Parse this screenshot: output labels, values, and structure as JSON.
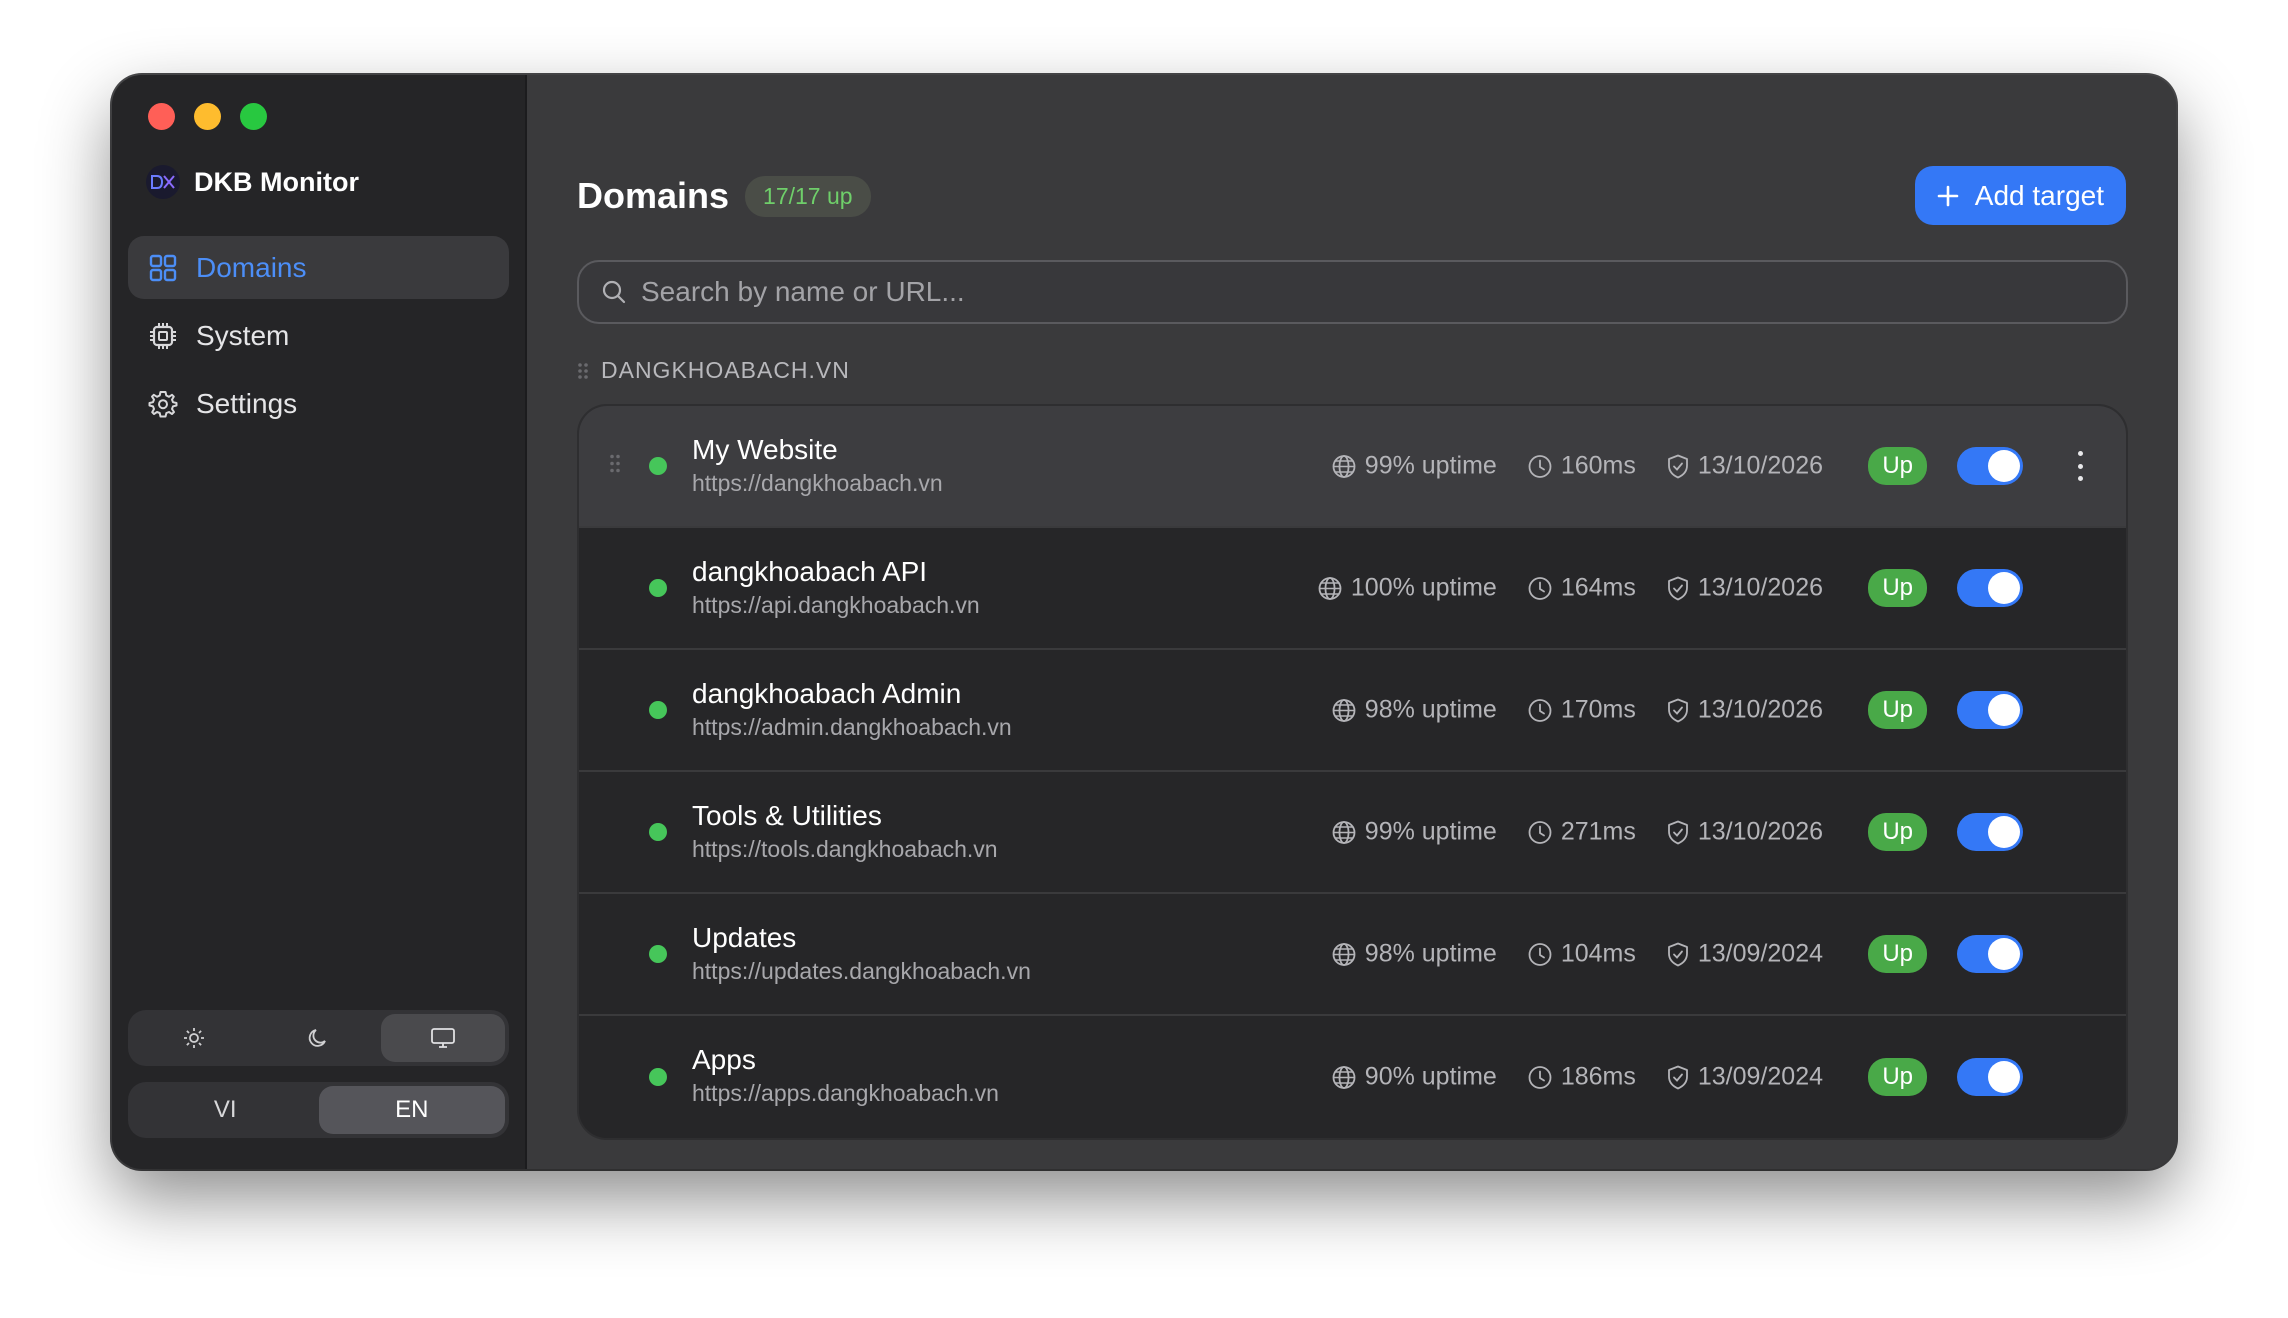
{
  "app": {
    "name": "DKB Monitor",
    "logo_text": "DKB"
  },
  "sidebar": {
    "items": [
      {
        "label": "Domains",
        "icon": "grid-icon",
        "active": true
      },
      {
        "label": "System",
        "icon": "cpu-icon",
        "active": false
      },
      {
        "label": "Settings",
        "icon": "gear-icon",
        "active": false
      }
    ],
    "theme": {
      "options": [
        "light",
        "dark",
        "system"
      ],
      "selected": "system"
    },
    "language": {
      "options": [
        "VI",
        "EN"
      ],
      "selected": "EN",
      "vi": "VI",
      "en": "EN"
    }
  },
  "header": {
    "title": "Domains",
    "count_badge": "17/17 up",
    "add_button_label": "Add target"
  },
  "search": {
    "placeholder": "Search by name or URL..."
  },
  "group": {
    "label": "DANGKHOABACH.VN"
  },
  "targets": [
    {
      "name": "My Website",
      "url": "https://dangkhoabach.vn",
      "uptime": "99% uptime",
      "latency": "160ms",
      "ssl_expiry": "13/10/2026",
      "status": "Up",
      "enabled": true
    },
    {
      "name": "dangkhoabach API",
      "url": "https://api.dangkhoabach.vn",
      "uptime": "100% uptime",
      "latency": "164ms",
      "ssl_expiry": "13/10/2026",
      "status": "Up",
      "enabled": true
    },
    {
      "name": "dangkhoabach Admin",
      "url": "https://admin.dangkhoabach.vn",
      "uptime": "98% uptime",
      "latency": "170ms",
      "ssl_expiry": "13/10/2026",
      "status": "Up",
      "enabled": true
    },
    {
      "name": "Tools & Utilities",
      "url": "https://tools.dangkhoabach.vn",
      "uptime": "99% uptime",
      "latency": "271ms",
      "ssl_expiry": "13/10/2026",
      "status": "Up",
      "enabled": true
    },
    {
      "name": "Updates",
      "url": "https://updates.dangkhoabach.vn",
      "uptime": "98% uptime",
      "latency": "104ms",
      "ssl_expiry": "13/09/2024",
      "status": "Up",
      "enabled": true
    },
    {
      "name": "Apps",
      "url": "https://apps.dangkhoabach.vn",
      "uptime": "90% uptime",
      "latency": "186ms",
      "ssl_expiry": "13/09/2024",
      "status": "Up",
      "enabled": true
    }
  ],
  "colors": {
    "accent": "#3478f6",
    "status_up": "#46c65a",
    "sidebar_active": "#4c8ef7"
  }
}
